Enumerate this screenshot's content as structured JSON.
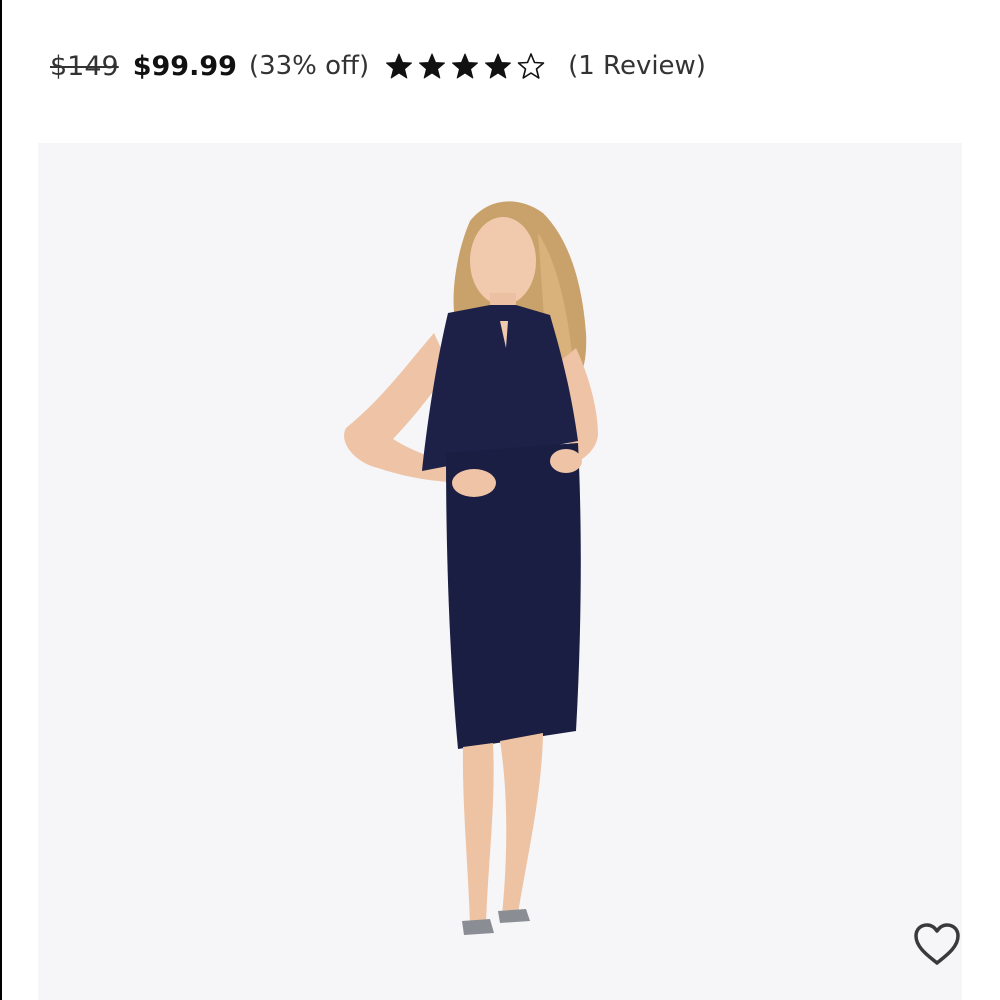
{
  "product": {
    "original_price": "$149",
    "sale_price": "$99.99",
    "discount": "(33% off)",
    "rating": 4,
    "rating_max": 5,
    "reviews_label": "(1 Review)"
  },
  "icons": {
    "star_filled": "star-filled-icon",
    "star_empty": "star-outline-icon",
    "wishlist": "heart-outline-icon"
  },
  "colors": {
    "dress": "#1d2147",
    "background": "#f6f6f8"
  }
}
